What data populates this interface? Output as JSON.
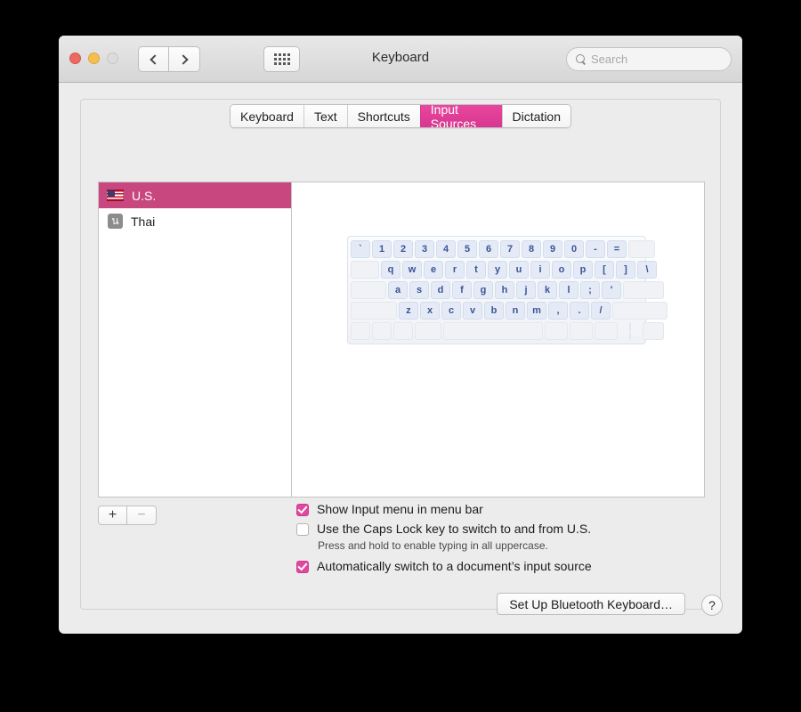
{
  "window": {
    "title": "Keyboard",
    "traffic_lights": [
      "close",
      "minimize",
      "zoom"
    ],
    "nav": {
      "back_icon": "chevron-left-icon",
      "forward_icon": "chevron-right-icon"
    },
    "show_all_icon": "grid-icon"
  },
  "search": {
    "placeholder": "Search",
    "value": "",
    "icon": "search-icon"
  },
  "tabs": [
    {
      "label": "Keyboard",
      "active": false
    },
    {
      "label": "Text",
      "active": false
    },
    {
      "label": "Shortcuts",
      "active": false
    },
    {
      "label": "Input Sources",
      "active": true
    },
    {
      "label": "Dictation",
      "active": false
    }
  ],
  "input_sources": [
    {
      "label": "U.S.",
      "icon": "us-flag-icon",
      "selected": true
    },
    {
      "label": "Thai",
      "icon": "thai-badge-icon",
      "glyph": "น",
      "selected": false
    }
  ],
  "list_buttons": {
    "add_label": "+",
    "remove_label": "−"
  },
  "keyboard_preview": {
    "layout_name": "U.S.",
    "rows": [
      {
        "keys": [
          "`",
          "1",
          "2",
          "3",
          "4",
          "5",
          "6",
          "7",
          "8",
          "9",
          "0",
          "-",
          "="
        ],
        "trailing_blanks": [
          30
        ]
      },
      {
        "leading_blanks": [
          32
        ],
        "keys": [
          "q",
          "w",
          "e",
          "r",
          "t",
          "y",
          "u",
          "i",
          "o",
          "p",
          "[",
          "]",
          "\\"
        ]
      },
      {
        "leading_blanks": [
          40
        ],
        "keys": [
          "a",
          "s",
          "d",
          "f",
          "g",
          "h",
          "j",
          "k",
          "l",
          ";",
          "'"
        ],
        "trailing_blanks": [
          46
        ]
      },
      {
        "leading_blanks": [
          52
        ],
        "keys": [
          "z",
          "x",
          "c",
          "v",
          "b",
          "n",
          "m",
          ",",
          ".",
          "/"
        ],
        "trailing_blanks": [
          62
        ]
      },
      {
        "leading_blanks": [
          22,
          22,
          22,
          30
        ],
        "spacebar": 112,
        "trailing_blanks": [
          26,
          26,
          26
        ],
        "arrow_stack": true,
        "final_blank": 24
      }
    ]
  },
  "options": [
    {
      "label": "Show Input menu in menu bar",
      "checked": true,
      "note": ""
    },
    {
      "label": "Use the Caps Lock key to switch to and from U.S.",
      "checked": false,
      "note": "Press and hold to enable typing in all uppercase."
    },
    {
      "label": "Automatically switch to a document’s input source",
      "checked": true,
      "note": ""
    }
  ],
  "footer": {
    "bluetooth_button": "Set Up Bluetooth Keyboard…",
    "help_button": "?"
  },
  "colors": {
    "tab_accent": "#e8479f",
    "selection": "#c9477f",
    "checkbox_accent": "#e0479d",
    "key_face": "#e4ebf7",
    "key_text": "#3d5494"
  }
}
